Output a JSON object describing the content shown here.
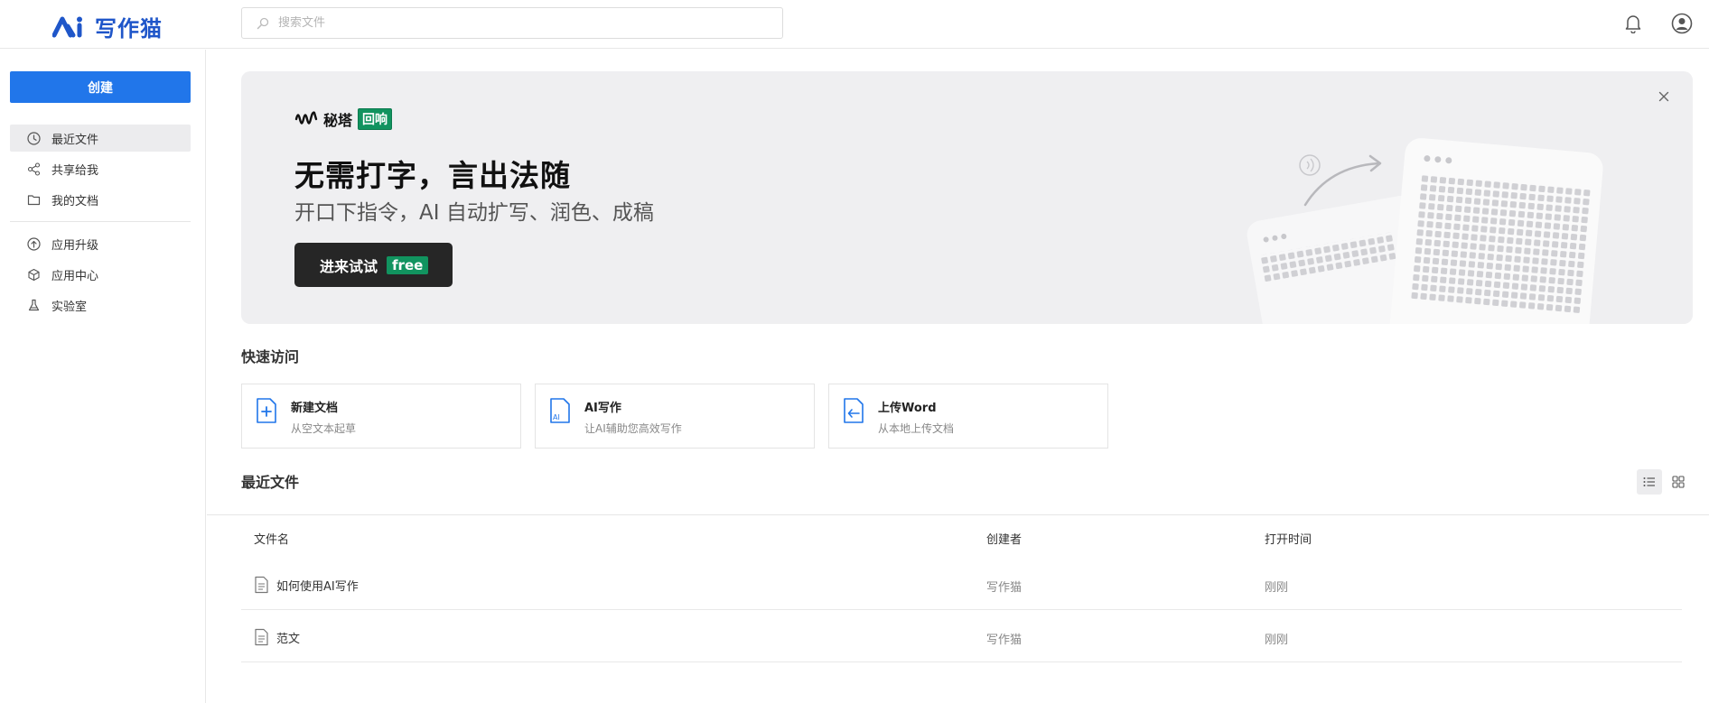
{
  "app": {
    "name": "写作猫"
  },
  "search": {
    "placeholder": "搜索文件"
  },
  "sidebar": {
    "create_label": "创建",
    "items": [
      {
        "label": "最近文件",
        "icon": "clock-icon",
        "active": true
      },
      {
        "label": "共享给我",
        "icon": "share-icon",
        "active": false
      },
      {
        "label": "我的文档",
        "icon": "folder-icon",
        "active": false
      },
      {
        "label": "应用升级",
        "icon": "upgrade-icon",
        "active": false
      },
      {
        "label": "应用中心",
        "icon": "cube-icon",
        "active": false
      },
      {
        "label": "实验室",
        "icon": "flask-icon",
        "active": false
      }
    ]
  },
  "banner": {
    "brand_name": "秘塔",
    "brand_tag": "回响",
    "title": "无需打字，言出法随",
    "subtitle": "开口下指令，AI 自动扩写、润色、成稿",
    "button_label": "进来试试",
    "button_badge": "free"
  },
  "quick_access": {
    "title": "快速访问",
    "cards": [
      {
        "title": "新建文档",
        "desc": "从空文本起草",
        "icon": "new-doc-icon"
      },
      {
        "title": "AI写作",
        "desc": "让AI辅助您高效写作",
        "icon": "ai-write-icon"
      },
      {
        "title": "上传Word",
        "desc": "从本地上传文档",
        "icon": "upload-word-icon"
      }
    ]
  },
  "recent": {
    "title": "最近文件",
    "columns": [
      "文件名",
      "创建者",
      "打开时间"
    ],
    "rows": [
      {
        "name": "如何使用AI写作",
        "creator": "写作猫",
        "opened": "刚刚"
      },
      {
        "name": "范文",
        "creator": "写作猫",
        "opened": "刚刚"
      }
    ]
  },
  "colors": {
    "brand": "#1f56c9",
    "primary": "#2176ea",
    "green": "#11935f"
  }
}
